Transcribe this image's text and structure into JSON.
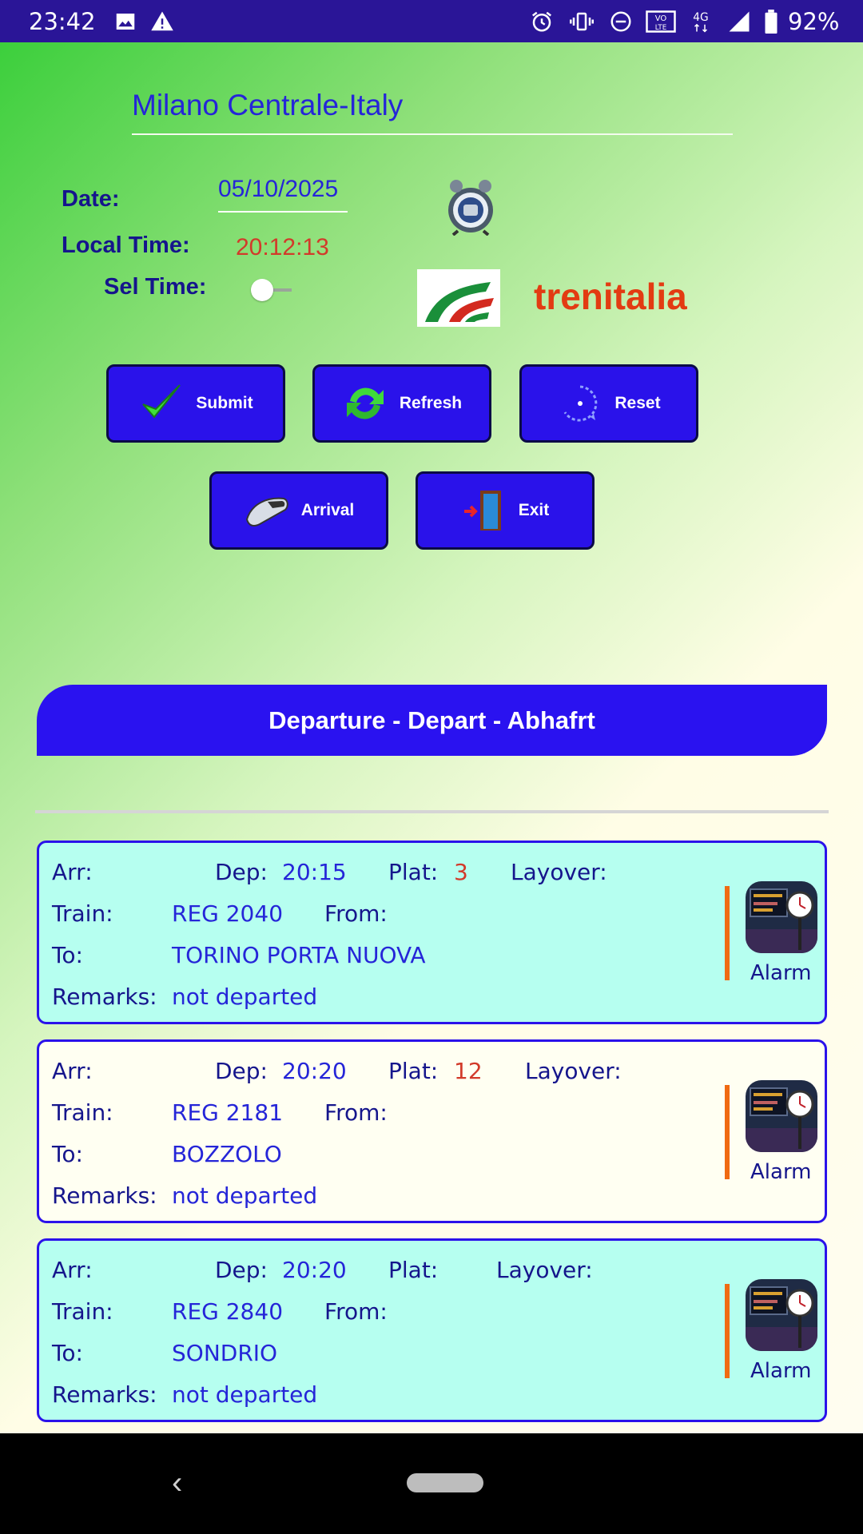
{
  "status_bar": {
    "time": "23:42",
    "battery": "92%",
    "icons": [
      "image-icon",
      "warning-icon",
      "alarm-icon",
      "vibrate-icon",
      "dnd-icon",
      "volte-icon",
      "4g-icon",
      "signal-icon",
      "battery-icon"
    ]
  },
  "station": {
    "title": "Milano Centrale-Italy"
  },
  "form": {
    "date_label": "Date:",
    "date_value": "05/10/2025",
    "local_time_label": "Local Time:",
    "local_time_value": "20:12:13",
    "sel_time_label": "Sel Time:"
  },
  "brand": {
    "name": "trenitalia",
    "color": "#e33b12"
  },
  "buttons": {
    "submit": "Submit",
    "refresh": "Refresh",
    "reset": "Reset",
    "arrival": "Arrival",
    "exit": "Exit"
  },
  "header": {
    "title": "Departure - Depart - Abhafrt"
  },
  "labels": {
    "arr": "Arr:",
    "dep": "Dep:",
    "plat": "Plat:",
    "layover": "Layover:",
    "train": "Train:",
    "from": "From:",
    "to": "To:",
    "remarks": "Remarks:",
    "alarm": "Alarm"
  },
  "departures": [
    {
      "dep": "20:15",
      "plat": "3",
      "train": "REG 2040",
      "to": "TORINO PORTA NUOVA",
      "remarks": "not departed",
      "bg": "#b6fff0"
    },
    {
      "dep": "20:20",
      "plat": "12",
      "train": "REG 2181",
      "to": "BOZZOLO",
      "remarks": "not departed",
      "bg": "#fffff2"
    },
    {
      "dep": "20:20",
      "plat": "",
      "train": "REG 2840",
      "to": "SONDRIO",
      "remarks": "not departed",
      "bg": "#b6fff0"
    }
  ],
  "colors": {
    "accent": "#2a12ea",
    "status_bar": "#2a1597",
    "label": "#15158c",
    "value": "#2525d8",
    "platform": "#d23a2a",
    "alarm_bar": "#f06a12"
  }
}
